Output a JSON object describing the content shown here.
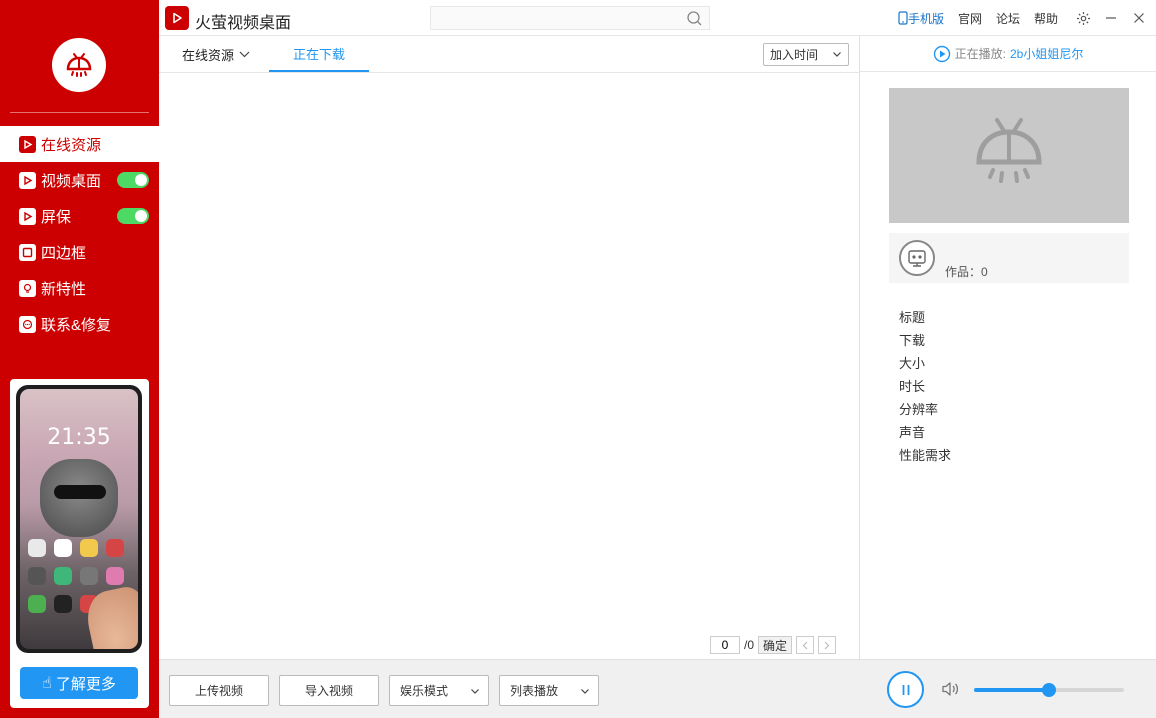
{
  "app": {
    "title": "火萤视频桌面"
  },
  "colors": {
    "brand": "#cc0000",
    "accent": "#2196f3",
    "toggle_on": "#4cd964"
  },
  "search": {
    "placeholder": "",
    "value": ""
  },
  "top_links": {
    "mobile": "手机版",
    "official": "官网",
    "forum": "论坛",
    "help": "帮助"
  },
  "sidebar": {
    "items": [
      {
        "label": "在线资源",
        "icon": "play-icon",
        "active": true
      },
      {
        "label": "视频桌面",
        "icon": "play-icon",
        "toggle": true
      },
      {
        "label": "屏保",
        "icon": "play-icon",
        "toggle": true
      },
      {
        "label": "四边框",
        "icon": "frame-icon"
      },
      {
        "label": "新特性",
        "icon": "bulb-icon"
      },
      {
        "label": "联系&修复",
        "icon": "chat-icon"
      }
    ],
    "promo": {
      "phone_time": "21:35",
      "button": "了解更多"
    }
  },
  "tabs": {
    "online": "在线资源",
    "downloading": "正在下载"
  },
  "sort": {
    "selected": "加入时间"
  },
  "pager": {
    "current": "0",
    "total": "/0",
    "confirm": "确定"
  },
  "right_panel": {
    "now_playing_label": "正在播放:",
    "now_playing_name": "2b小姐姐尼尔",
    "works_label": "作品：0",
    "info": [
      "标题",
      "下载",
      "大小",
      "时长",
      "分辨率",
      "声音",
      "性能需求"
    ]
  },
  "bottom": {
    "upload": "上传视频",
    "import": "导入视频",
    "mode": "娱乐模式",
    "playback": "列表播放",
    "volume": 0.5
  }
}
